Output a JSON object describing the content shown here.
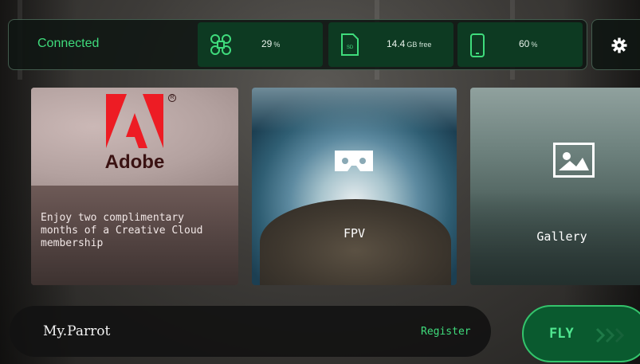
{
  "status": {
    "connection": "Connected",
    "drone_battery": {
      "value": "29",
      "unit": "%"
    },
    "storage": {
      "value": "14.4",
      "unit": "GB free",
      "icon_text": "SD"
    },
    "phone_battery": {
      "value": "60",
      "unit": "%"
    }
  },
  "cards": {
    "adobe": {
      "brand": "Adobe",
      "promo": "Enjoy two complimentary months of a Creative Cloud membership"
    },
    "fpv": {
      "label": "FPV"
    },
    "gallery": {
      "label": "Gallery"
    }
  },
  "bottom_bar": {
    "title": "My.Parrot",
    "register_label": "Register"
  },
  "fly_button": {
    "label": "FLY"
  },
  "colors": {
    "accent_green": "#3fdc7c",
    "pill_green": "#0d3a22",
    "adobe_red": "#ed1c24"
  },
  "icons": [
    "drone-icon",
    "sd-card-icon",
    "phone-icon",
    "gear-icon",
    "vr-headset-icon",
    "image-icon",
    "adobe-logo",
    "chevrons-right-icon"
  ]
}
